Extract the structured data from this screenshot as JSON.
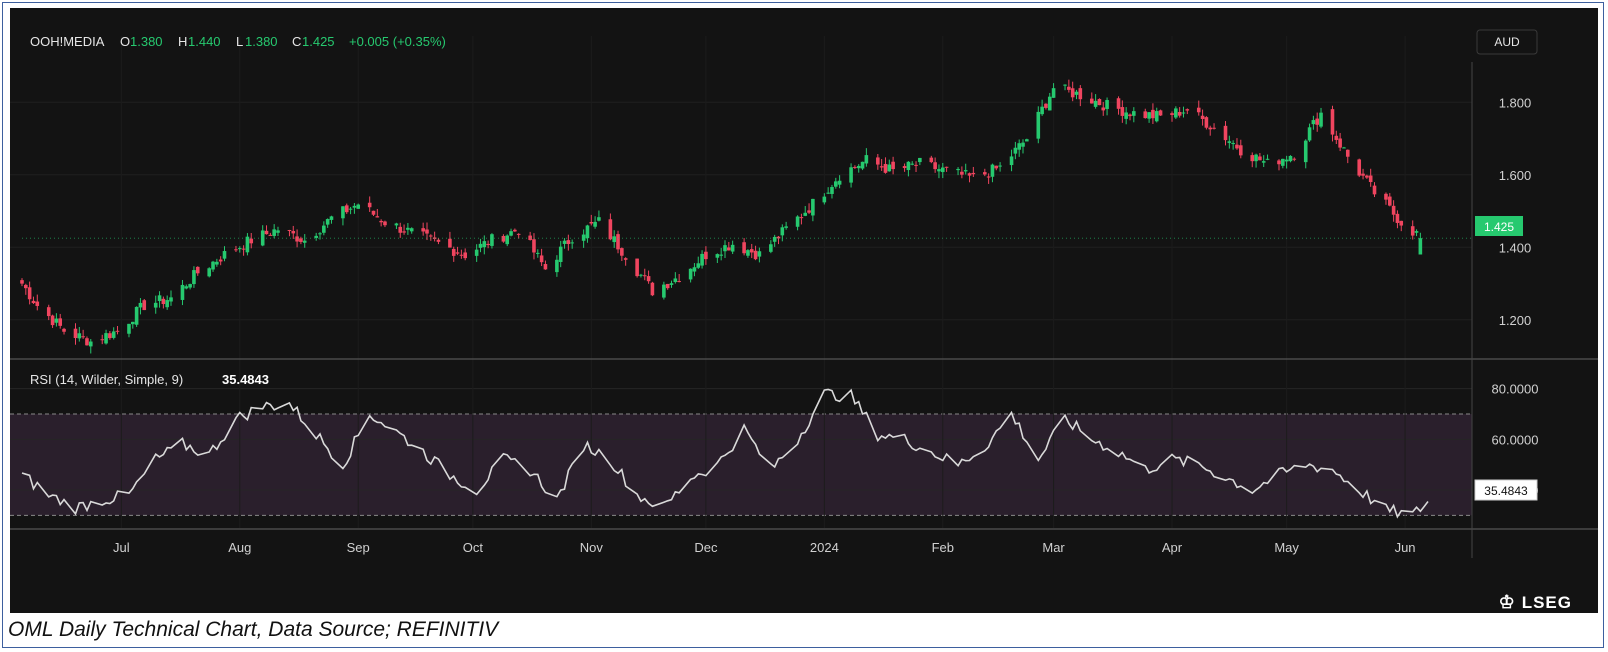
{
  "header": {
    "symbol": "OOH!MEDIA",
    "open_label": "O",
    "open": "1.380",
    "high_label": "H",
    "high": "1.440",
    "low_label": "L",
    "low": "1.380",
    "close_label": "C",
    "close": "1.425",
    "change": "+0.005 (+0.35%)",
    "currency": "AUD"
  },
  "rsi_header": {
    "label": "RSI (14, Wilder, Simple, 9)",
    "value": "35.4843"
  },
  "price_badge": "1.425",
  "rsi_badge": "35.4843",
  "brand": "LSEG",
  "caption": "OML Daily Technical Chart, Data Source; REFINITIV",
  "colors": {
    "up": "#26c96f",
    "down": "#f0455f",
    "background": "#131313",
    "rsi_line": "#d9d9d9",
    "rsi_band": "#2a1f2c"
  },
  "chart_data": [
    {
      "type": "candlestick",
      "title": "OOH!MEDIA",
      "ylim": [
        1.1,
        1.9
      ],
      "yticks": [
        "1.200",
        "1.400",
        "1.600",
        "1.800"
      ],
      "x_ticks": [
        "Jul",
        "Aug",
        "Sep",
        "Oct",
        "Nov",
        "Dec",
        "2024",
        "Feb",
        "Mar",
        "Apr",
        "May",
        "Jun"
      ],
      "x_start": "2023-06-05",
      "x_end": "2024-06-07",
      "close_path": [
        [
          "2023-06-05",
          1.3
        ],
        [
          "2023-06-09",
          1.24
        ],
        [
          "2023-06-16",
          1.17
        ],
        [
          "2023-06-23",
          1.14
        ],
        [
          "2023-06-30",
          1.17
        ],
        [
          "2023-07-07",
          1.24
        ],
        [
          "2023-07-14",
          1.26
        ],
        [
          "2023-07-21",
          1.33
        ],
        [
          "2023-07-28",
          1.38
        ],
        [
          "2023-08-04",
          1.42
        ],
        [
          "2023-08-11",
          1.45
        ],
        [
          "2023-08-18",
          1.42
        ],
        [
          "2023-08-25",
          1.48
        ],
        [
          "2023-09-01",
          1.52
        ],
        [
          "2023-09-08",
          1.47
        ],
        [
          "2023-09-15",
          1.44
        ],
        [
          "2023-09-22",
          1.41
        ],
        [
          "2023-09-29",
          1.38
        ],
        [
          "2023-10-06",
          1.42
        ],
        [
          "2023-10-13",
          1.45
        ],
        [
          "2023-10-20",
          1.34
        ],
        [
          "2023-10-27",
          1.43
        ],
        [
          "2023-11-03",
          1.47
        ],
        [
          "2023-11-10",
          1.38
        ],
        [
          "2023-11-17",
          1.28
        ],
        [
          "2023-11-24",
          1.32
        ],
        [
          "2023-12-01",
          1.38
        ],
        [
          "2023-12-08",
          1.41
        ],
        [
          "2023-12-15",
          1.38
        ],
        [
          "2023-12-22",
          1.45
        ],
        [
          "2023-12-29",
          1.52
        ],
        [
          "2024-01-05",
          1.6
        ],
        [
          "2024-01-12",
          1.64
        ],
        [
          "2024-01-19",
          1.61
        ],
        [
          "2024-01-26",
          1.63
        ],
        [
          "2024-02-02",
          1.61
        ],
        [
          "2024-02-09",
          1.59
        ],
        [
          "2024-02-16",
          1.62
        ],
        [
          "2024-02-23",
          1.7
        ],
        [
          "2024-03-01",
          1.84
        ],
        [
          "2024-03-08",
          1.82
        ],
        [
          "2024-03-15",
          1.79
        ],
        [
          "2024-03-22",
          1.77
        ],
        [
          "2024-03-29",
          1.76
        ],
        [
          "2024-04-05",
          1.78
        ],
        [
          "2024-04-12",
          1.73
        ],
        [
          "2024-04-19",
          1.67
        ],
        [
          "2024-04-26",
          1.63
        ],
        [
          "2024-05-03",
          1.66
        ],
        [
          "2024-05-10",
          1.77
        ],
        [
          "2024-05-17",
          1.65
        ],
        [
          "2024-05-24",
          1.55
        ],
        [
          "2024-05-31",
          1.47
        ],
        [
          "2024-06-06",
          1.42
        ]
      ],
      "last": {
        "open": 1.38,
        "high": 1.44,
        "low": 1.38,
        "close": 1.425,
        "change": 0.005,
        "change_pct": 0.35
      }
    },
    {
      "type": "line",
      "title": "RSI (14, Wilder, Simple, 9)",
      "ylim": [
        25,
        85
      ],
      "yticks": [
        "40.0000",
        "60.0000",
        "80.0000"
      ],
      "bands": [
        30,
        70
      ],
      "path": [
        [
          "2023-06-05",
          46
        ],
        [
          "2023-06-12",
          38
        ],
        [
          "2023-06-19",
          33
        ],
        [
          "2023-06-26",
          36
        ],
        [
          "2023-07-03",
          38
        ],
        [
          "2023-07-10",
          52
        ],
        [
          "2023-07-17",
          58
        ],
        [
          "2023-07-24",
          54
        ],
        [
          "2023-07-31",
          68
        ],
        [
          "2023-08-07",
          73
        ],
        [
          "2023-08-14",
          74
        ],
        [
          "2023-08-21",
          62
        ],
        [
          "2023-08-28",
          50
        ],
        [
          "2023-09-04",
          70
        ],
        [
          "2023-09-11",
          63
        ],
        [
          "2023-09-18",
          55
        ],
        [
          "2023-09-25",
          46
        ],
        [
          "2023-10-02",
          40
        ],
        [
          "2023-10-09",
          52
        ],
        [
          "2023-10-16",
          48
        ],
        [
          "2023-10-23",
          36
        ],
        [
          "2023-10-30",
          58
        ],
        [
          "2023-11-06",
          52
        ],
        [
          "2023-11-13",
          38
        ],
        [
          "2023-11-20",
          33
        ],
        [
          "2023-11-27",
          45
        ],
        [
          "2023-12-04",
          50
        ],
        [
          "2023-12-11",
          64
        ],
        [
          "2023-12-18",
          48
        ],
        [
          "2023-12-25",
          60
        ],
        [
          "2024-01-01",
          78
        ],
        [
          "2024-01-08",
          77
        ],
        [
          "2024-01-15",
          62
        ],
        [
          "2024-01-22",
          60
        ],
        [
          "2024-01-29",
          55
        ],
        [
          "2024-02-05",
          50
        ],
        [
          "2024-02-12",
          57
        ],
        [
          "2024-02-19",
          70
        ],
        [
          "2024-02-26",
          52
        ],
        [
          "2024-03-04",
          68
        ],
        [
          "2024-03-11",
          60
        ],
        [
          "2024-03-18",
          55
        ],
        [
          "2024-03-25",
          48
        ],
        [
          "2024-04-01",
          52
        ],
        [
          "2024-04-08",
          50
        ],
        [
          "2024-04-15",
          45
        ],
        [
          "2024-04-22",
          40
        ],
        [
          "2024-04-29",
          46
        ],
        [
          "2024-05-06",
          50
        ],
        [
          "2024-05-13",
          48
        ],
        [
          "2024-05-20",
          40
        ],
        [
          "2024-05-27",
          32
        ],
        [
          "2024-06-03",
          30
        ],
        [
          "2024-06-07",
          35.48
        ]
      ],
      "last": 35.4843
    }
  ]
}
